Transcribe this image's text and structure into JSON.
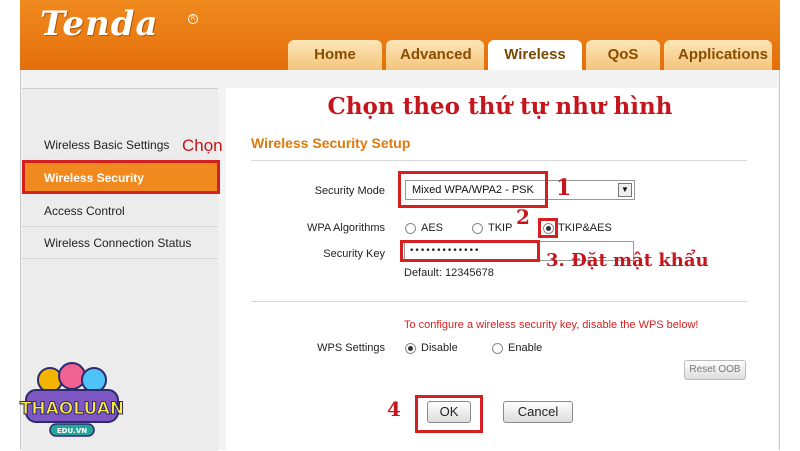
{
  "brand": {
    "logo": "Tenda",
    "logo_mark": "R"
  },
  "tabs": [
    {
      "label": "Home"
    },
    {
      "label": "Advanced"
    },
    {
      "label": "Wireless"
    },
    {
      "label": "QoS"
    },
    {
      "label": "Applications"
    }
  ],
  "sidebar": {
    "items": [
      {
        "label": "Wireless Basic Settings"
      },
      {
        "label": "Wireless Security"
      },
      {
        "label": "Access Control"
      },
      {
        "label": "Wireless Connection Status"
      }
    ]
  },
  "annotations": {
    "heading": "Chọn theo thứ tự như hình",
    "chon": "Chọn",
    "step1": "1",
    "step2": "2",
    "step3": "3. Đặt mật khẩu",
    "step4": "4"
  },
  "form": {
    "section_title": "Wireless Security Setup",
    "security_mode_label": "Security Mode",
    "security_mode_value": "Mixed WPA/WPA2 - PSK",
    "wpa_label": "WPA Algorithms",
    "wpa_options": [
      "AES",
      "TKIP",
      "TKIP&AES"
    ],
    "wpa_selected": "TKIP&AES",
    "key_label": "Security Key",
    "key_value": "•••••••••••••",
    "key_default": "Default: 12345678",
    "wps_warning": "To configure a wireless security key, disable the WPS below!",
    "wps_label": "WPS Settings",
    "wps_options": [
      "Disable",
      "Enable"
    ],
    "wps_selected": "Disable",
    "reset_label": "Reset OOB",
    "ok_label": "OK",
    "cancel_label": "Cancel"
  },
  "watermark": {
    "text": "THAOLUAN",
    "sub": "EDU.VN"
  },
  "colors": {
    "brand_orange": "#f08a1f",
    "annotation_red": "#c4161c"
  }
}
